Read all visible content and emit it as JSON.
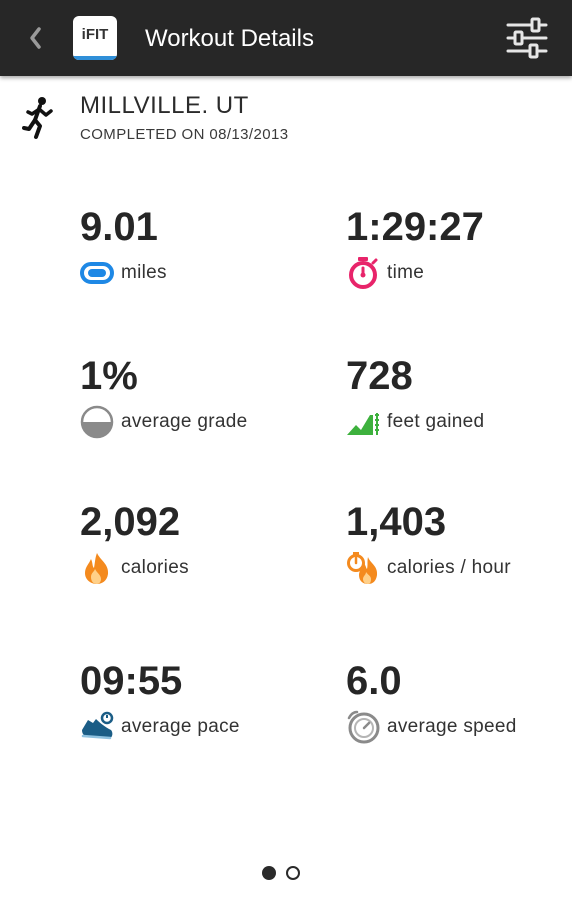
{
  "app_bar": {
    "title": "Workout Details",
    "logo_text": "iFIT",
    "back_icon": "chevron-left-icon",
    "settings_icon": "sliders-icon",
    "background_color": "#272727"
  },
  "workout": {
    "activity_icon": "runner-icon",
    "location": "MILLVILLE. UT",
    "completed": "COMPLETED ON 08/13/2013"
  },
  "stats": [
    {
      "value": "9.01",
      "label": "miles",
      "icon": "distance-icon",
      "color": "#1e88e5"
    },
    {
      "value": "1:29:27",
      "label": "time",
      "icon": "stopwatch-icon",
      "color": "#e8246a"
    },
    {
      "value": "1%",
      "label": "average grade",
      "icon": "grade-half-circle-icon",
      "color": "#8a8a8a"
    },
    {
      "value": "728",
      "label": "feet gained",
      "icon": "elevation-icon",
      "color": "#3db13d"
    },
    {
      "value": "2,092",
      "label": "calories",
      "icon": "flame-icon",
      "color": "#f48a1e"
    },
    {
      "value": "1,403",
      "label": "calories / hour",
      "icon": "flame-timer-icon",
      "color": "#f48a1e"
    },
    {
      "value": "09:55",
      "label": "average pace",
      "icon": "shoe-icon",
      "color": "#1b5d86"
    },
    {
      "value": "6.0",
      "label": "average speed",
      "icon": "speedometer-icon",
      "color": "#8a8a8a"
    }
  ],
  "pager": {
    "pages": 2,
    "current_page": 1
  }
}
